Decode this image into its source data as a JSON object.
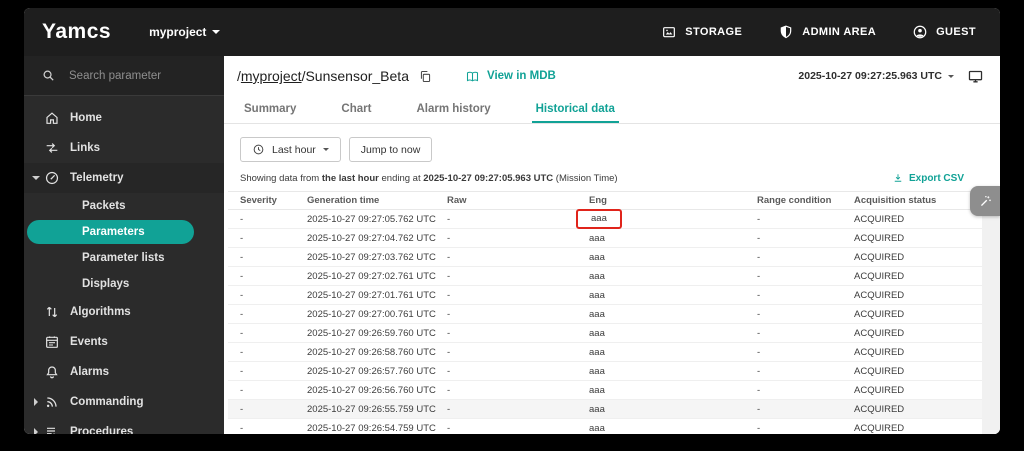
{
  "topbar": {
    "logo": "Yamcs",
    "instance": {
      "label": "myproject"
    },
    "actions": [
      {
        "label": "STORAGE",
        "icon": "storage-icon"
      },
      {
        "label": "ADMIN AREA",
        "icon": "shield-icon"
      },
      {
        "label": "GUEST",
        "icon": "user-icon"
      }
    ]
  },
  "sidebar": {
    "search": {
      "placeholder": "Search parameter",
      "icon": "search-icon"
    },
    "items": [
      {
        "label": "Home",
        "icon": "home-icon",
        "type": "top"
      },
      {
        "label": "Links",
        "icon": "links-icon",
        "type": "top"
      },
      {
        "label": "Telemetry",
        "icon": "telemetry-icon",
        "type": "group",
        "expanded": true
      },
      {
        "label": "Packets",
        "type": "sub"
      },
      {
        "label": "Parameters",
        "type": "sub",
        "active": true
      },
      {
        "label": "Parameter lists",
        "type": "sub"
      },
      {
        "label": "Displays",
        "type": "sub"
      },
      {
        "label": "Algorithms",
        "icon": "algorithms-icon",
        "type": "top"
      },
      {
        "label": "Events",
        "icon": "events-icon",
        "type": "top"
      },
      {
        "label": "Alarms",
        "icon": "alarms-icon",
        "type": "top"
      },
      {
        "label": "Commanding",
        "icon": "commanding-icon",
        "type": "group",
        "expanded": false
      },
      {
        "label": "Procedures",
        "icon": "procedures-icon",
        "type": "group",
        "expanded": false
      }
    ]
  },
  "header": {
    "breadcrumb": {
      "root": "/",
      "project": "myproject",
      "separator": "/",
      "name": "Sunsensor_Beta"
    },
    "view_in_mdb": "View in MDB",
    "time": "2025-10-27 09:27:25.963 UTC"
  },
  "tabs": [
    {
      "label": "Summary",
      "active": false
    },
    {
      "label": "Chart",
      "active": false
    },
    {
      "label": "Alarm history",
      "active": false
    },
    {
      "label": "Historical data",
      "active": true
    }
  ],
  "toolbar": {
    "range_button": "Last hour",
    "jump_button": "Jump to now"
  },
  "summary": {
    "prefix": "Showing data from ",
    "range_bold": "the last hour",
    "middle": " ending at ",
    "end_time_bold": "2025-10-27 09:27:05.963 UTC",
    "suffix": " (Mission Time)",
    "export_label": "Export CSV"
  },
  "table": {
    "columns": [
      {
        "key": "severity",
        "label": "Severity"
      },
      {
        "key": "generation_time",
        "label": "Generation time"
      },
      {
        "key": "raw",
        "label": "Raw"
      },
      {
        "key": "eng",
        "label": "Eng"
      },
      {
        "key": "range_condition",
        "label": "Range condition"
      },
      {
        "key": "acquisition_status",
        "label": "Acquisition status"
      }
    ],
    "rows": [
      {
        "severity": "-",
        "generation_time": "2025-10-27 09:27:05.762 UTC",
        "raw": "-",
        "eng": "aaa",
        "range_condition": "-",
        "acquisition_status": "ACQUIRED"
      },
      {
        "severity": "-",
        "generation_time": "2025-10-27 09:27:04.762 UTC",
        "raw": "-",
        "eng": "aaa",
        "range_condition": "-",
        "acquisition_status": "ACQUIRED"
      },
      {
        "severity": "-",
        "generation_time": "2025-10-27 09:27:03.762 UTC",
        "raw": "-",
        "eng": "aaa",
        "range_condition": "-",
        "acquisition_status": "ACQUIRED"
      },
      {
        "severity": "-",
        "generation_time": "2025-10-27 09:27:02.761 UTC",
        "raw": "-",
        "eng": "aaa",
        "range_condition": "-",
        "acquisition_status": "ACQUIRED"
      },
      {
        "severity": "-",
        "generation_time": "2025-10-27 09:27:01.761 UTC",
        "raw": "-",
        "eng": "aaa",
        "range_condition": "-",
        "acquisition_status": "ACQUIRED"
      },
      {
        "severity": "-",
        "generation_time": "2025-10-27 09:27:00.761 UTC",
        "raw": "-",
        "eng": "aaa",
        "range_condition": "-",
        "acquisition_status": "ACQUIRED"
      },
      {
        "severity": "-",
        "generation_time": "2025-10-27 09:26:59.760 UTC",
        "raw": "-",
        "eng": "aaa",
        "range_condition": "-",
        "acquisition_status": "ACQUIRED"
      },
      {
        "severity": "-",
        "generation_time": "2025-10-27 09:26:58.760 UTC",
        "raw": "-",
        "eng": "aaa",
        "range_condition": "-",
        "acquisition_status": "ACQUIRED"
      },
      {
        "severity": "-",
        "generation_time": "2025-10-27 09:26:57.760 UTC",
        "raw": "-",
        "eng": "aaa",
        "range_condition": "-",
        "acquisition_status": "ACQUIRED"
      },
      {
        "severity": "-",
        "generation_time": "2025-10-27 09:26:56.760 UTC",
        "raw": "-",
        "eng": "aaa",
        "range_condition": "-",
        "acquisition_status": "ACQUIRED"
      },
      {
        "severity": "-",
        "generation_time": "2025-10-27 09:26:55.759 UTC",
        "raw": "-",
        "eng": "aaa",
        "range_condition": "-",
        "acquisition_status": "ACQUIRED"
      },
      {
        "severity": "-",
        "generation_time": "2025-10-27 09:26:54.759 UTC",
        "raw": "-",
        "eng": "aaa",
        "range_condition": "-",
        "acquisition_status": "ACQUIRED"
      }
    ],
    "hovered_row_index": 10
  },
  "annotation": {
    "type": "highlight-box",
    "color": "#e0241b",
    "row_index": 0,
    "column_key": "eng"
  },
  "colors": {
    "accent": "#11a296",
    "topbar_bg": "#1e1e1e",
    "sidebar_bg": "#2b2b2b",
    "annotation_red": "#e0241b"
  }
}
